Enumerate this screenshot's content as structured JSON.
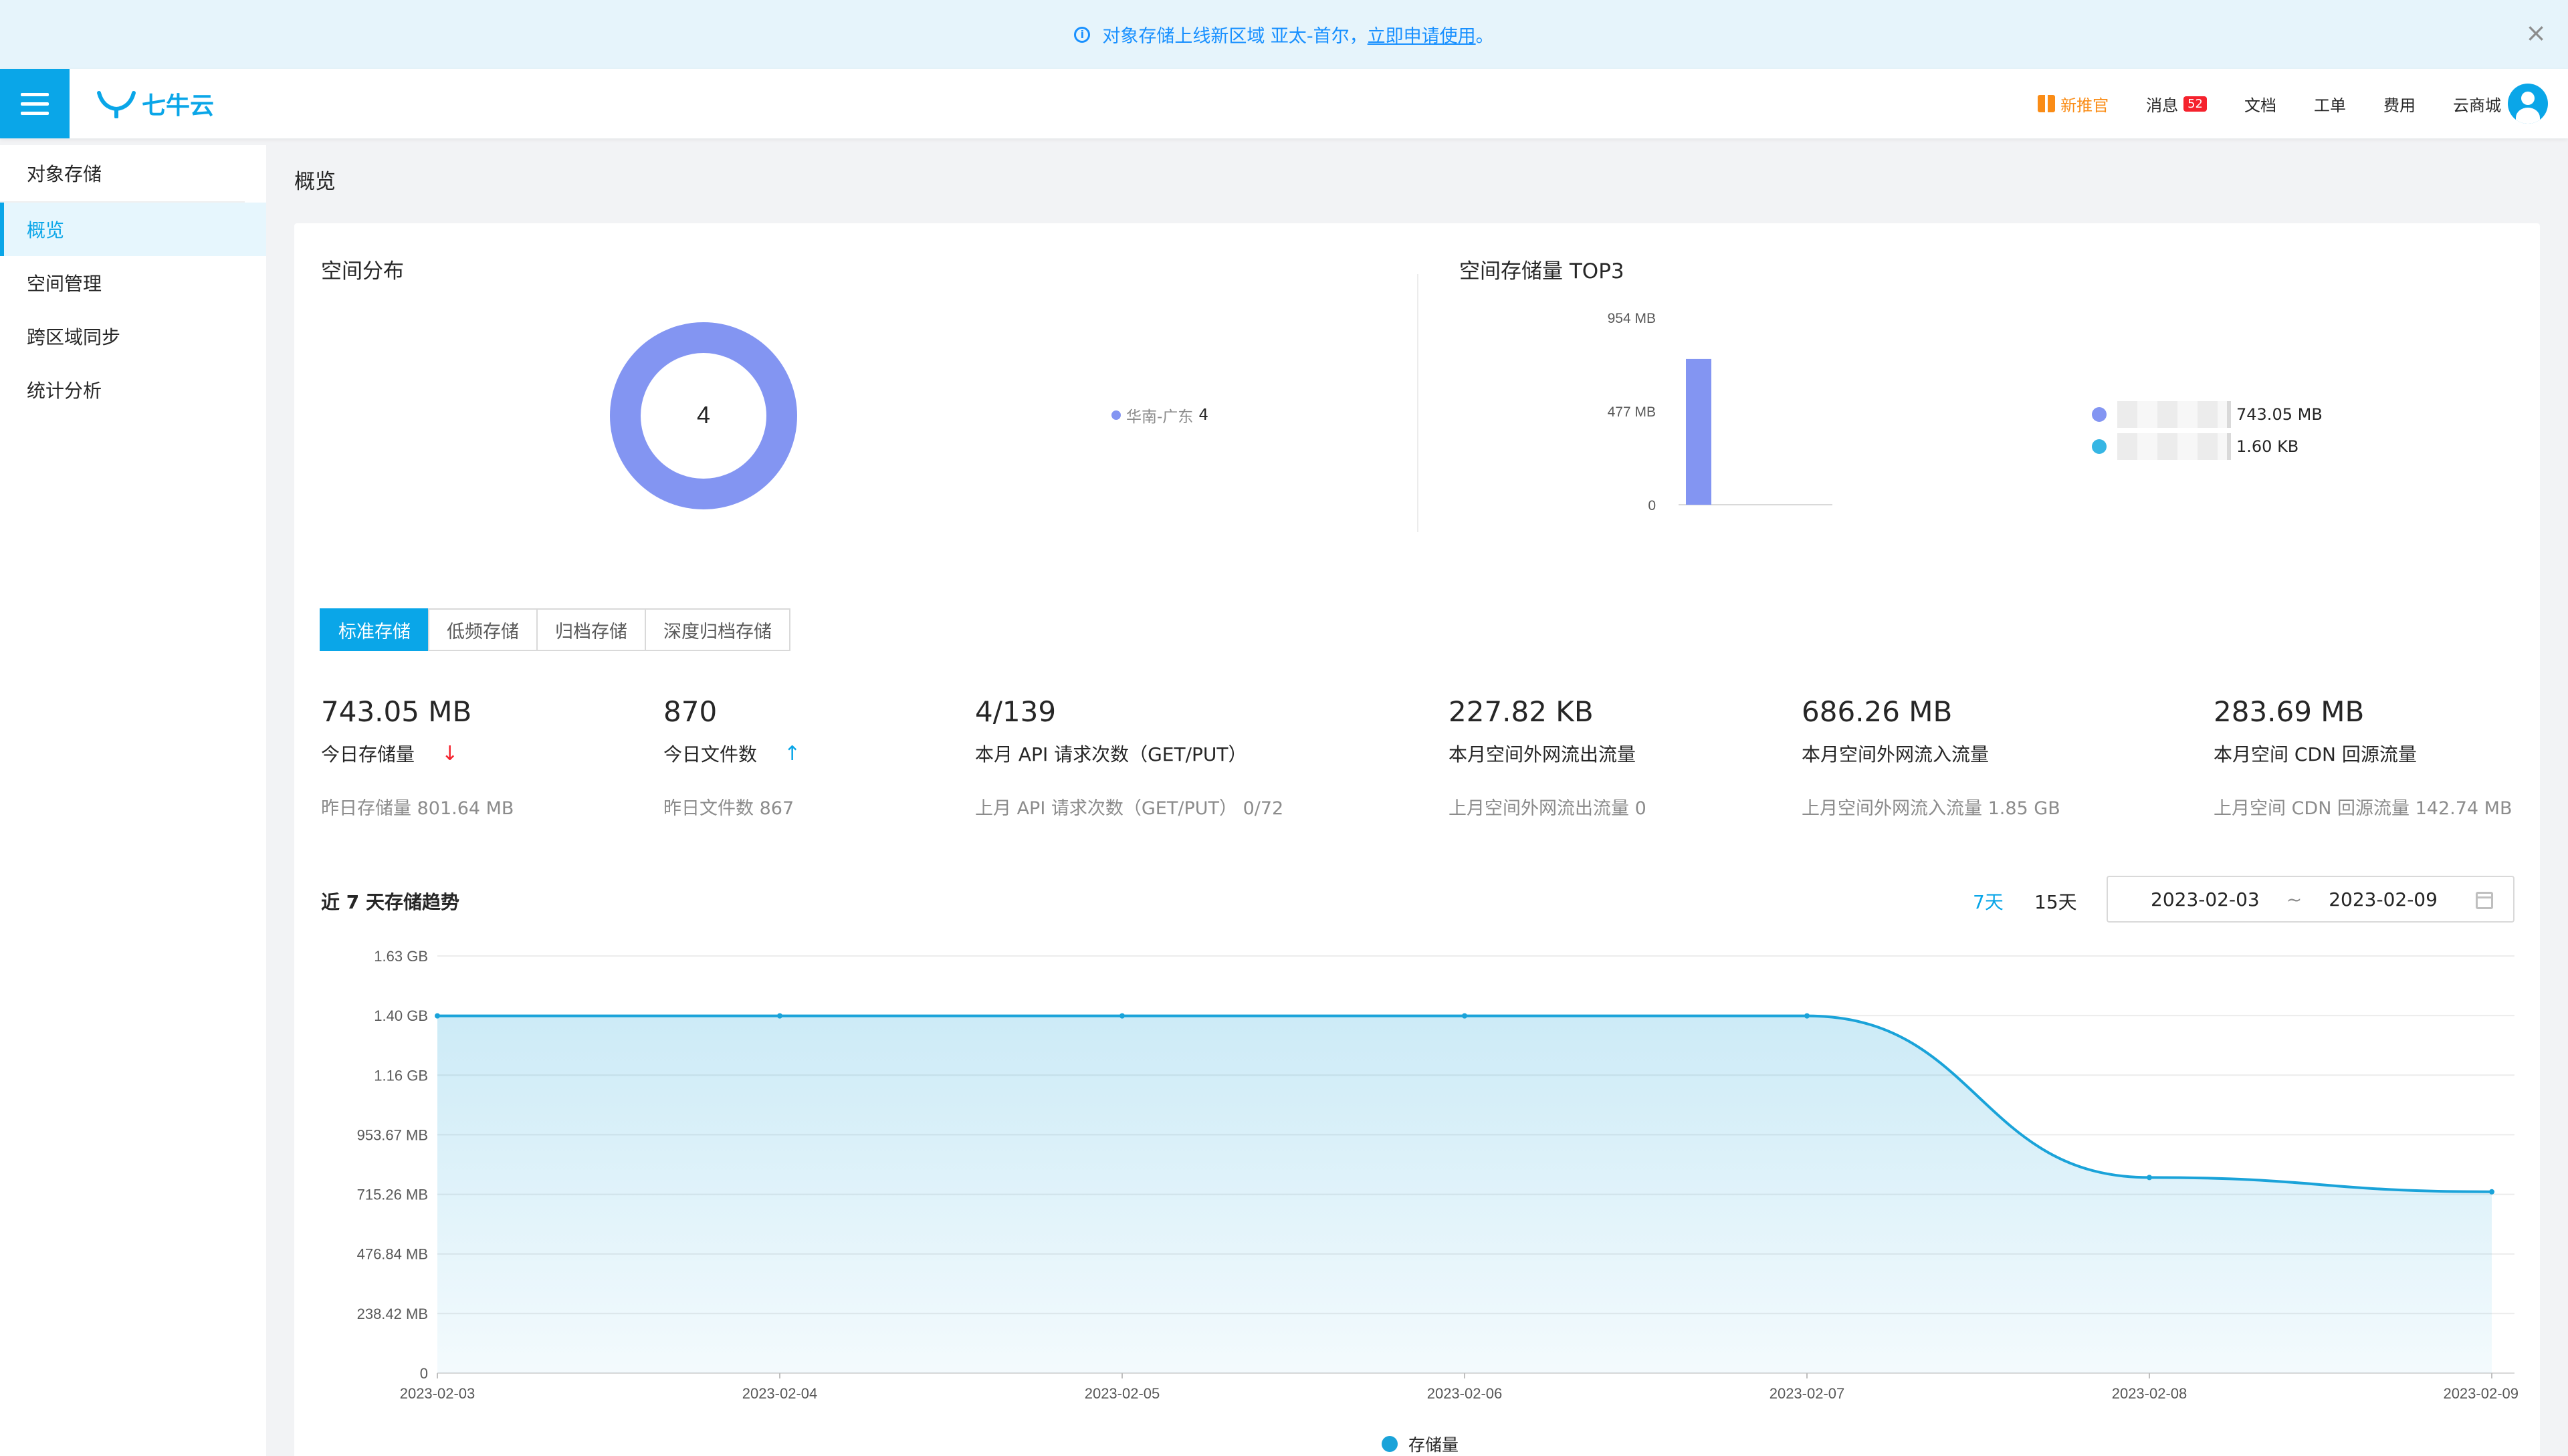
{
  "announcement": {
    "text": "对象存储上线新区域 亚太-首尔，",
    "link": "立即申请使用",
    "suffix": "。"
  },
  "header": {
    "logo": "七牛云",
    "nav": {
      "recommend": "新推官",
      "messages": "消息",
      "message_count": "52",
      "docs": "文档",
      "tickets": "工单",
      "billing": "费用",
      "marketplace": "云商城"
    }
  },
  "sidebar": {
    "title": "对象存储",
    "items": [
      {
        "label": "概览",
        "active": true
      },
      {
        "label": "空间管理",
        "active": false
      },
      {
        "label": "跨区域同步",
        "active": false
      },
      {
        "label": "统计分析",
        "active": false
      }
    ]
  },
  "page_title": "概览",
  "space_distribution": {
    "title": "空间分布",
    "center_value": "4",
    "legend": [
      {
        "name": "华南-广东",
        "value": "4",
        "color": "#8395f2"
      }
    ]
  },
  "top3": {
    "title": "空间存储量 TOP3",
    "legend": [
      {
        "value": "743.05 MB",
        "color": "#8395f2"
      },
      {
        "value": "1.60 KB",
        "color": "#36b6e4"
      }
    ]
  },
  "storage_tabs": [
    "标准存储",
    "低频存储",
    "归档存储",
    "深度归档存储"
  ],
  "stats": [
    {
      "value": "743.05 MB",
      "label": "今日存储量",
      "trend": "down",
      "sub": "昨日存储量 801.64 MB"
    },
    {
      "value": "870",
      "label": "今日文件数",
      "trend": "up",
      "sub": "昨日文件数 867"
    },
    {
      "value": "4/139",
      "label": "本月 API 请求次数（GET/PUT）",
      "trend": "",
      "sub": "上月 API 请求次数（GET/PUT）  0/72"
    },
    {
      "value": "227.82 KB",
      "label": "本月空间外网流出流量",
      "trend": "",
      "sub": "上月空间外网流出流量 0"
    },
    {
      "value": "686.26 MB",
      "label": "本月空间外网流入流量",
      "trend": "",
      "sub": "上月空间外网流入流量 1.85 GB"
    },
    {
      "value": "283.69 MB",
      "label": "本月空间 CDN 回源流量",
      "trend": "",
      "sub": "上月空间 CDN 回源流量 142.74 MB"
    }
  ],
  "trend": {
    "title": "近 7 天存储趋势",
    "range_options": [
      "7天",
      "15天"
    ],
    "active_range": "7天",
    "date_start": "2023-02-03",
    "date_sep": "~",
    "date_end": "2023-02-09",
    "legend": "存储量"
  },
  "chart_data": [
    {
      "type": "pie",
      "title": "空间分布",
      "categories": [
        "华南-广东"
      ],
      "values": [
        4
      ],
      "colors": [
        "#8395f2"
      ]
    },
    {
      "type": "bar",
      "title": "空间存储量 TOP3",
      "y_ticks": [
        "0",
        "477 MB",
        "954 MB"
      ],
      "ylim": [
        0,
        954
      ],
      "yunit": "MB",
      "values": [
        743.05,
        0.0016
      ],
      "colors": [
        "#8395f2",
        "#36b6e4"
      ]
    },
    {
      "type": "area",
      "title": "近 7 天存储趋势",
      "x": [
        "2023-02-03",
        "2023-02-04",
        "2023-02-05",
        "2023-02-06",
        "2023-02-07",
        "2023-02-08",
        "2023-02-09"
      ],
      "y_ticks": [
        "0",
        "238.42 MB",
        "476.84 MB",
        "715.26 MB",
        "953.67 MB",
        "1.16 GB",
        "1.40 GB",
        "1.63 GB"
      ],
      "ylim": [
        0,
        1709.51
      ],
      "yunit": "MB",
      "series": [
        {
          "name": "存储量",
          "values": [
            1464,
            1464,
            1464,
            1464,
            1464,
            801.64,
            743.05
          ]
        }
      ],
      "color": "#1aa3d9"
    }
  ]
}
